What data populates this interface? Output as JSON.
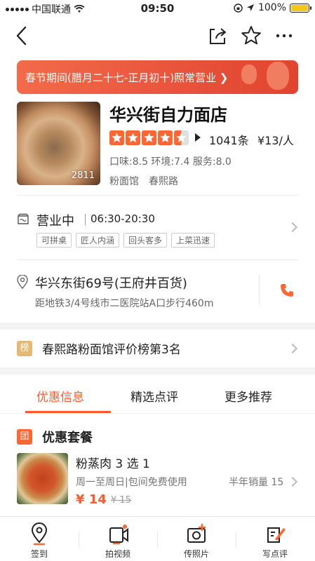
{
  "status_bar": {
    "carrier": "中国联通",
    "time": "09:50",
    "battery": "100%"
  },
  "nav": {
    "back_icon": "back-arrow-icon",
    "share_icon": "share-icon",
    "favorite_icon": "star-icon",
    "more_icon": "more-icon"
  },
  "banner": {
    "text": "春节期间(腊月二十七-正月初十)照常营业 ❯",
    "color": "#e8533a"
  },
  "shop": {
    "photo_count": "2811",
    "name": "华兴街自力面店",
    "rating_stars": 4.5,
    "review_count": "1041条",
    "price": "¥13/人",
    "scores": "口味:8.5  环境:7.4  服务:8.0",
    "category": "粉面馆",
    "area": "春熙路"
  },
  "hours": {
    "status": "营业中",
    "time": "06:30-20:30",
    "features": [
      "可拼桌",
      "匠人内涵",
      "回头客多",
      "上菜迅速"
    ]
  },
  "location": {
    "address": "华兴东街69号(王府井百货)",
    "distance": "距地铁3/4号线市二医院站A口步行460m"
  },
  "ranking": {
    "badge": "榜",
    "text": "春熙路粉面馆评价榜第3名"
  },
  "tabs": [
    {
      "label": "优惠信息",
      "active": true
    },
    {
      "label": "精选点评",
      "active": false
    },
    {
      "label": "更多推荐",
      "active": false
    }
  ],
  "deals": {
    "badge": "团",
    "title": "优惠套餐",
    "item": {
      "name": "粉蒸肉 3 选 1",
      "usage": "周一至周日|包间免费使用",
      "sales": "半年销量 15",
      "price": "¥ 14",
      "original_price": "¥ 15"
    }
  },
  "bottom_bar": [
    {
      "label": "签到",
      "icon": "checkin-location-icon"
    },
    {
      "label": "拍视频",
      "icon": "video-camera-icon"
    },
    {
      "label": "传照片",
      "icon": "photo-upload-icon"
    },
    {
      "label": "写点评",
      "icon": "write-review-icon"
    }
  ],
  "colors": {
    "accent": "#ff5a2e",
    "star": "#ff6633",
    "rank_badge": "#e6b874"
  }
}
